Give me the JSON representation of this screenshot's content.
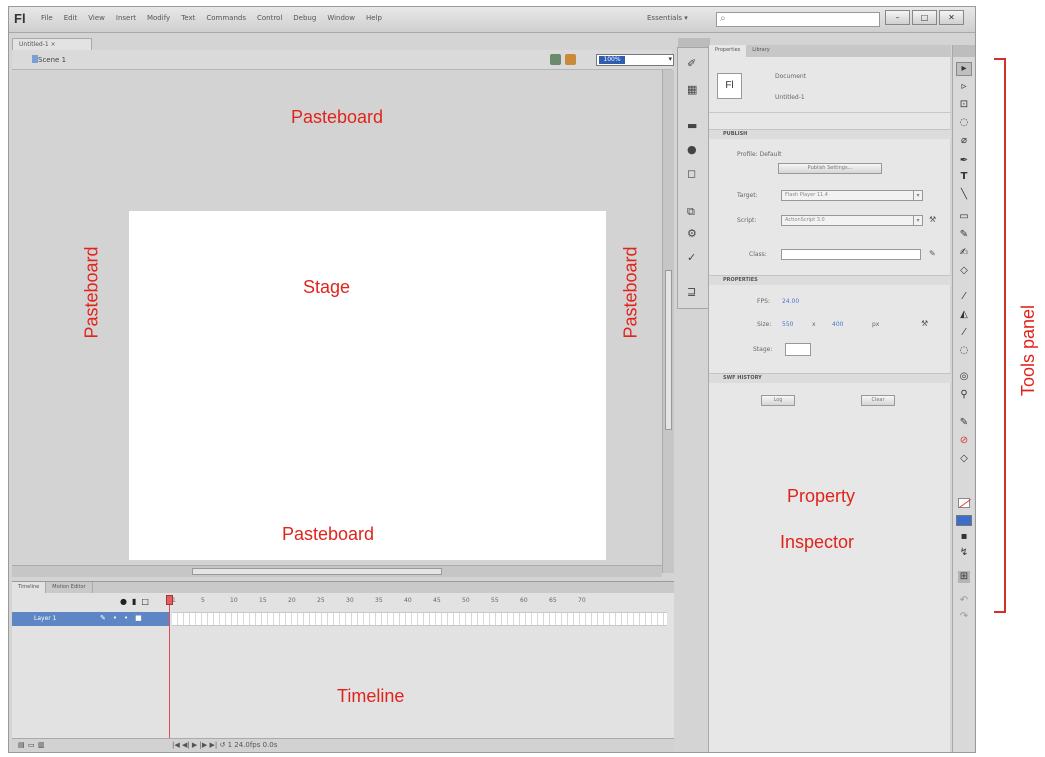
{
  "menubar": {
    "logo": "Fl",
    "items": [
      "File",
      "Edit",
      "View",
      "Insert",
      "Modify",
      "Text",
      "Commands",
      "Control",
      "Debug",
      "Window",
      "Help"
    ],
    "workspace": "Essentials ▾",
    "search_icon": "search-icon",
    "window_controls": [
      "–",
      "□",
      "✕"
    ]
  },
  "document": {
    "tab_label": "Untitled-1 ×",
    "scene_label": "Scene 1",
    "zoom": "100%"
  },
  "timeline": {
    "tabs": [
      "Timeline",
      "Motion Editor"
    ],
    "header_icons": [
      "●",
      "▮",
      "□"
    ],
    "frame_numbers": [
      "1",
      "5",
      "10",
      "15",
      "20",
      "25",
      "30",
      "35",
      "40",
      "45",
      "50",
      "55",
      "60",
      "65",
      "70"
    ],
    "layer_name": "Layer 1",
    "layer_icons": [
      "✎",
      "•",
      "•",
      "■"
    ],
    "footer_controls": "|◀ ◀| ▶ |▶ ▶| ↺ 1 24.0fps 0.0s"
  },
  "property_inspector": {
    "tabs": [
      "Properties",
      "Library"
    ],
    "doc_badge": "Fl",
    "doc_type": "Document",
    "doc_name": "Untitled-1",
    "publish": {
      "header": "PUBLISH",
      "profile_label": "Profile: Default",
      "settings_button": "Publish Settings...",
      "target_label": "Target:",
      "target_value": "Flash Player 11.4",
      "script_label": "Script:",
      "script_value": "ActionScript 3.0",
      "class_label": "Class:"
    },
    "properties": {
      "header": "PROPERTIES",
      "fps_label": "FPS:",
      "fps_value": "24.00",
      "size_label": "Size:",
      "width_value": "550",
      "x_sep": "x",
      "height_value": "400",
      "unit": "px",
      "stage_label": "Stage:"
    },
    "swf_history": {
      "header": "SWF HISTORY",
      "log_button": "Log",
      "clear_button": "Clear"
    }
  },
  "tools": {
    "icons": [
      "▸",
      "▹",
      "⊡",
      "◌",
      "⌀",
      "✒",
      "T",
      "╲",
      "▭",
      "✎",
      "✍",
      "◇",
      "⁄",
      "◭",
      "⁄",
      "◌",
      "◎",
      "⚲",
      "✎",
      "⊘",
      "◇",
      "▬",
      "▪",
      "↯"
    ]
  },
  "annotations": {
    "pasteboard_top": "Pasteboard",
    "pasteboard_bottom": "Pasteboard",
    "pasteboard_left": "Pasteboard",
    "pasteboard_right": "Pasteboard",
    "stage": "Stage",
    "timeline": "Timeline",
    "property_inspector_line1": "Property",
    "property_inspector_line2": "Inspector",
    "tools_panel": "Tools panel"
  },
  "colors": {
    "annotation": "#e0241c",
    "stage": "#ffffff",
    "pasteboard": "#d3d3d3",
    "layer_selected": "#5e86c5",
    "fill_swatch": "#3b6ec9"
  }
}
